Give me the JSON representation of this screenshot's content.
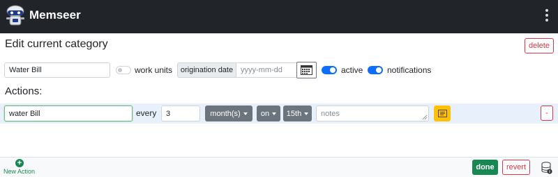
{
  "app": {
    "title": "Memseer",
    "logo_icon": "robot-logo-icon",
    "menu_icon": "kebab-menu-icon"
  },
  "category": {
    "heading": "Edit current category",
    "delete_label": "delete",
    "name_value": "Water Bill",
    "work_units": {
      "label": "work units",
      "on": false
    },
    "origination_label": "origination date",
    "origination_placeholder": "yyyy-mm-dd",
    "calendar_icon": "calendar-icon",
    "active": {
      "label": "active",
      "on": true
    },
    "notifications": {
      "label": "notifications",
      "on": true
    }
  },
  "actions": {
    "title": "Actions:",
    "rows": [
      {
        "name_value": "water Bill",
        "every_label": "every",
        "interval_value": "3",
        "unit_selected": "month(s)",
        "on_selected": "on",
        "day_selected": "15th",
        "notes_placeholder": "notes",
        "notes_icon": "note-icon",
        "remove_label": "-"
      }
    ]
  },
  "footer": {
    "new_action_icon": "plus-circle-icon",
    "new_action_label": "New Action",
    "done_label": "done",
    "revert_label": "revert",
    "database_icon": "database-info-icon"
  },
  "colors": {
    "topbar_bg": "#212529",
    "primary": "#0d6efd",
    "success": "#198754",
    "danger": "#dc3545",
    "warning": "#ffc107",
    "secondary": "#6c757d",
    "row_highlight": "#e8f1fb"
  }
}
